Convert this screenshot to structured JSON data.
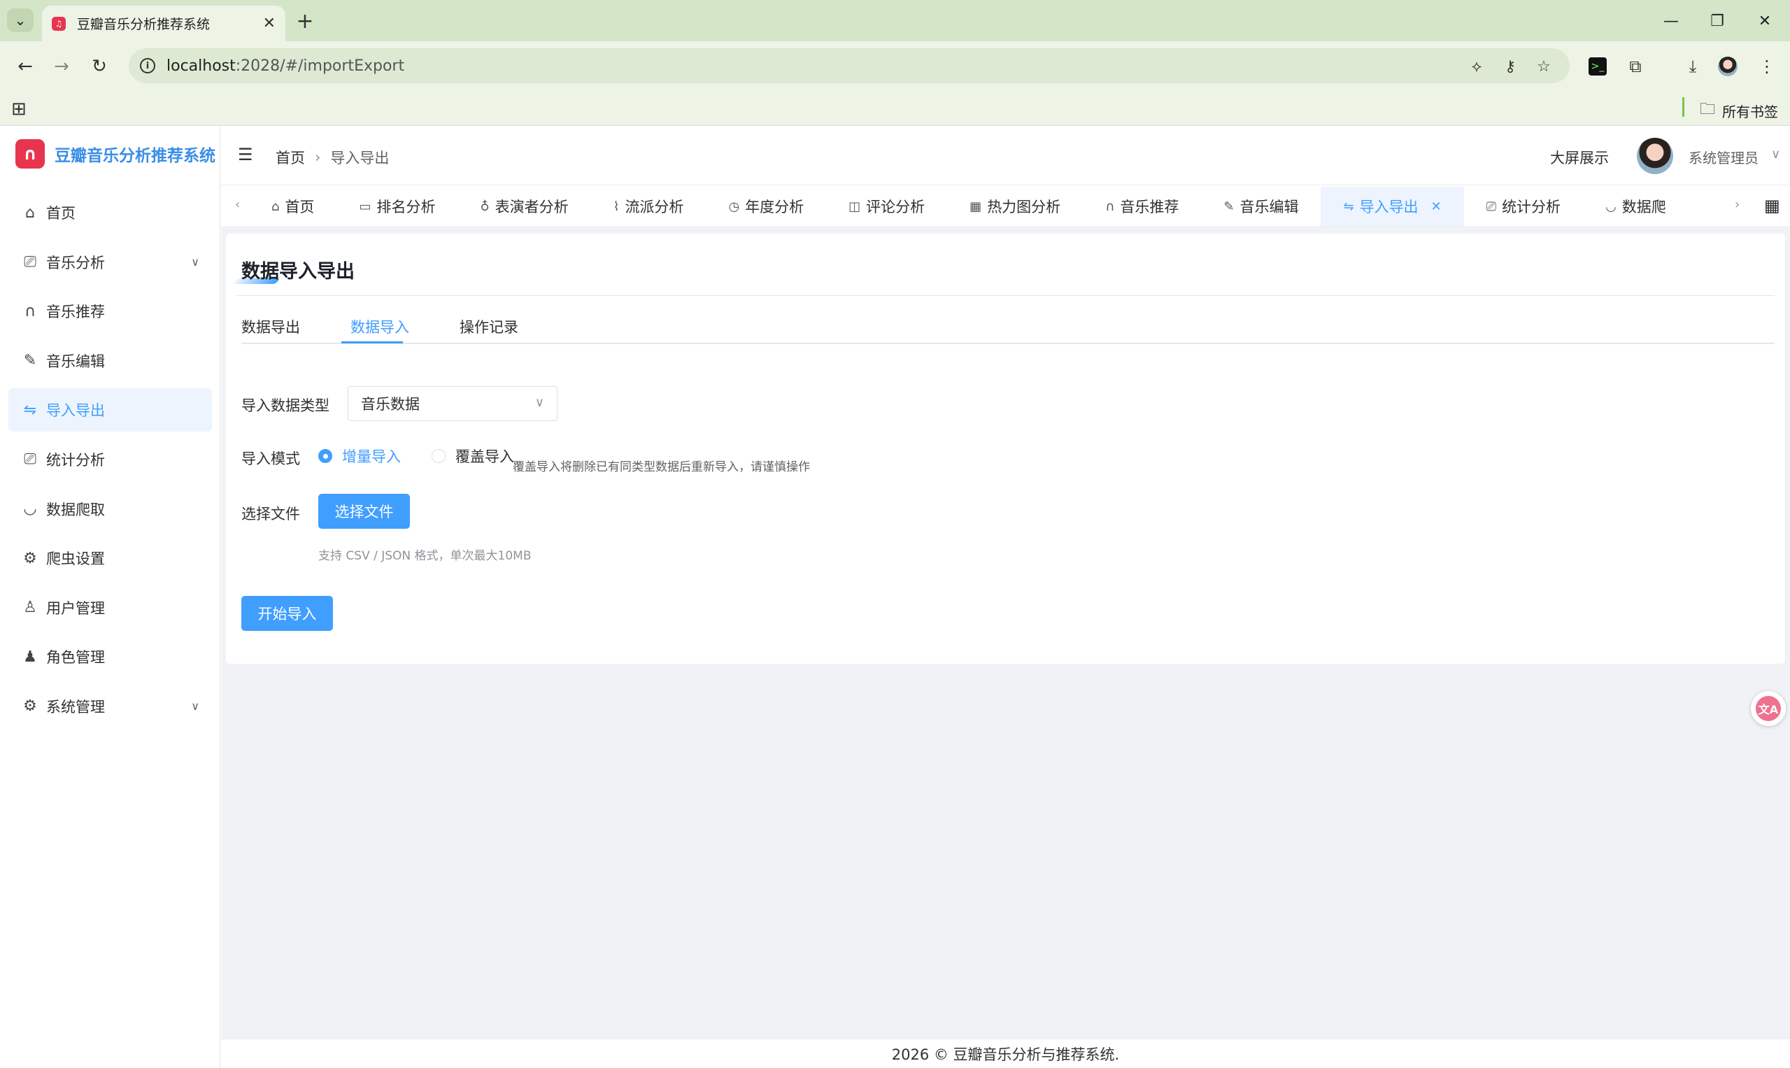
{
  "browser": {
    "tab_title": "豆瓣音乐分析推荐系统",
    "url_host": "localhost",
    "url_rest": ":2028/#/importExport",
    "bookmarks_label": "所有书签"
  },
  "app": {
    "logo_text": "豆瓣音乐分析推荐系统",
    "brand_color": "#409eff"
  },
  "sidebar": {
    "items": [
      {
        "label": "首页",
        "icon": "home-icon"
      },
      {
        "label": "音乐分析",
        "icon": "monitor-icon"
      },
      {
        "label": "音乐推荐",
        "icon": "headphones-icon"
      },
      {
        "label": "音乐编辑",
        "icon": "edit-icon"
      },
      {
        "label": "导入导出",
        "icon": "switch-icon"
      },
      {
        "label": "统计分析",
        "icon": "monitor-icon"
      },
      {
        "label": "数据爬取",
        "icon": "bowl-icon"
      },
      {
        "label": "爬虫设置",
        "icon": "gear-icon"
      },
      {
        "label": "用户管理",
        "icon": "user-icon"
      },
      {
        "label": "角色管理",
        "icon": "user-filled-icon"
      },
      {
        "label": "系统管理",
        "icon": "gear-icon"
      }
    ]
  },
  "header": {
    "breadcrumb_home": "首页",
    "breadcrumb_current": "导入导出",
    "big_screen": "大屏展示",
    "user_name": "系统管理员"
  },
  "tags": [
    "首页",
    "排名分析",
    "表演者分析",
    "流派分析",
    "年度分析",
    "评论分析",
    "热力图分析",
    "音乐推荐",
    "音乐编辑",
    "导入导出",
    "统计分析",
    "数据爬"
  ],
  "page": {
    "title": "数据导入导出",
    "tabs": [
      "数据导出",
      "数据导入",
      "操作记录"
    ],
    "active_tab": "数据导入",
    "type_label": "导入数据类型",
    "type_value": "音乐数据",
    "mode_label": "导入模式",
    "mode_incremental": "增量导入",
    "mode_overwrite": "覆盖导入",
    "mode_overwrite_hint": "覆盖导入将删除已有同类型数据后重新导入，请谨慎操作",
    "file_label": "选择文件",
    "file_button": "选择文件",
    "file_tip": "支持 CSV / JSON 格式，单次最大10MB",
    "start_button": "开始导入"
  },
  "footer": {
    "text": "2026 © 豆瓣音乐分析与推荐系统."
  }
}
